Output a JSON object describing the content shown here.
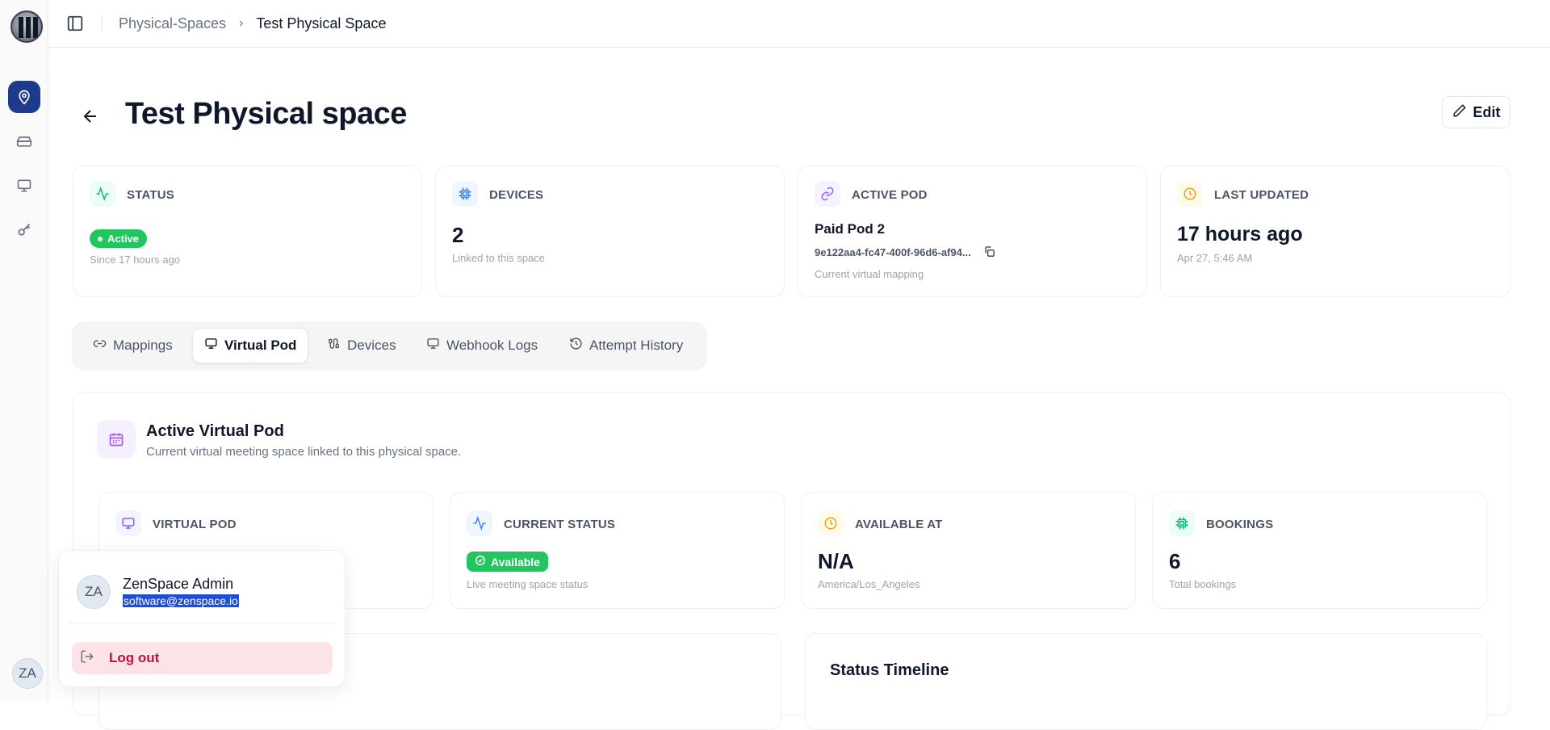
{
  "breadcrumb": {
    "parent": "Physical-Spaces",
    "current": "Test Physical Space"
  },
  "page": {
    "title": "Test Physical space",
    "edit_label": "Edit"
  },
  "stats": {
    "status": {
      "label": "STATUS",
      "badge": "Active",
      "sub": "Since 17 hours ago"
    },
    "devices": {
      "label": "DEVICES",
      "value": "2",
      "sub": "Linked to this space"
    },
    "active_pod": {
      "label": "ACTIVE POD",
      "name": "Paid Pod 2",
      "id": "9e122aa4-fc47-400f-96d6-af94...",
      "sub": "Current virtual mapping"
    },
    "last_updated": {
      "label": "LAST UPDATED",
      "value": "17 hours ago",
      "sub": "Apr 27, 5:46 AM"
    }
  },
  "tabs": [
    "Mappings",
    "Virtual Pod",
    "Devices",
    "Webhook Logs",
    "Attempt History"
  ],
  "virtual_pod_section": {
    "title": "Active Virtual Pod",
    "subtitle": "Current virtual meeting space linked to this physical space.",
    "cards": {
      "virtual_pod": {
        "label": "VIRTUAL POD"
      },
      "current_status": {
        "label": "CURRENT STATUS",
        "badge": "Available",
        "sub": "Live meeting space status"
      },
      "available_at": {
        "label": "AVAILABLE AT",
        "value": "N/A",
        "sub": "America/Los_Angeles"
      },
      "bookings": {
        "label": "BOOKINGS",
        "value": "6",
        "sub": "Total bookings"
      }
    },
    "timeline_title": "Status Timeline"
  },
  "user_menu": {
    "initials": "ZA",
    "name": "ZenSpace Admin",
    "email": "software@zenspace.io",
    "logout_label": "Log out"
  },
  "colors": {
    "accent": "#1e3a8a",
    "success": "#22c55e",
    "danger": "#be123c"
  }
}
